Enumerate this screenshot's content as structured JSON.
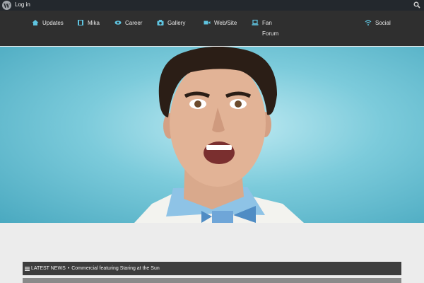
{
  "adminbar": {
    "login_label": "Log in"
  },
  "nav": {
    "items": [
      {
        "label": "Updates",
        "icon": "home-icon"
      },
      {
        "label": "Mika",
        "icon": "film-icon"
      },
      {
        "label": "Career",
        "icon": "eye-icon"
      },
      {
        "label": "Gallery",
        "icon": "camera-icon"
      },
      {
        "label": "Web/Site",
        "icon": "video-icon"
      },
      {
        "label": "Fan Forum",
        "icon": "laptop-icon"
      },
      {
        "label": "Social",
        "icon": "wifi-icon"
      }
    ]
  },
  "news": {
    "label": "LATEST NEWS",
    "separator": "•",
    "headline": "Commercial featuring Staring at the Sun"
  },
  "colors": {
    "accent": "#5fc4e0",
    "nav_bg": "#2f2f2f",
    "adminbar_bg": "#23282d"
  }
}
